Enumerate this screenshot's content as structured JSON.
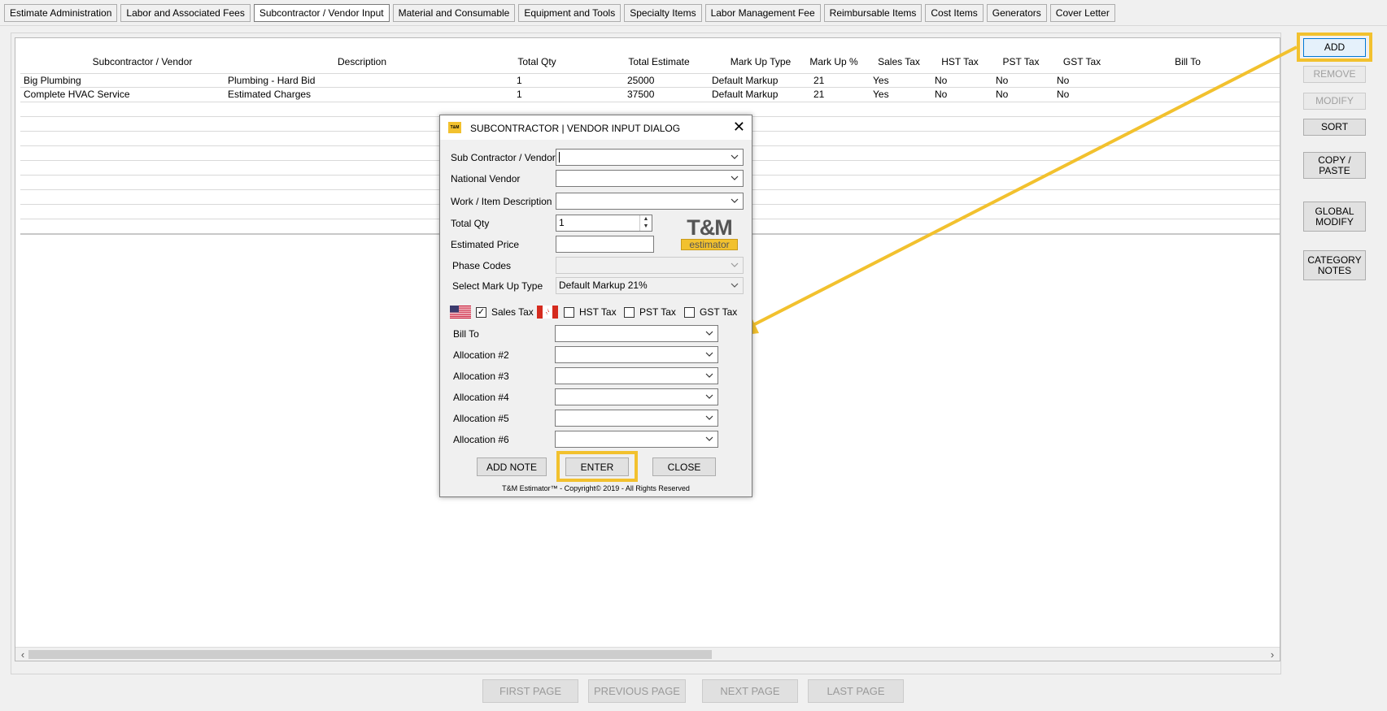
{
  "tabs": [
    {
      "label": "Estimate Administration"
    },
    {
      "label": "Labor and Associated Fees"
    },
    {
      "label": "Subcontractor / Vendor Input"
    },
    {
      "label": "Material and Consumable"
    },
    {
      "label": "Equipment and Tools"
    },
    {
      "label": "Specialty Items"
    },
    {
      "label": "Labor Management Fee"
    },
    {
      "label": "Reimbursable Items"
    },
    {
      "label": "Cost Items"
    },
    {
      "label": "Generators"
    },
    {
      "label": "Cover Letter"
    }
  ],
  "active_tab": "Subcontractor / Vendor Input",
  "table": {
    "columns": [
      "Subcontractor / Vendor",
      "Description",
      "Total Qty",
      "Total Estimate",
      "Mark Up Type",
      "Mark Up %",
      "Sales Tax",
      "HST Tax",
      "PST Tax",
      "GST Tax",
      "Bill To"
    ],
    "rows": [
      {
        "vendor": "Big Plumbing",
        "description": "Plumbing - Hard Bid",
        "qty": "1",
        "estimate": "25000",
        "markup_type": "Default Markup",
        "markup_pct": "21",
        "sales_tax": "Yes",
        "hst": "No",
        "pst": "No",
        "gst": "No",
        "bill_to": ""
      },
      {
        "vendor": "Complete HVAC Service",
        "description": "Estimated Charges",
        "qty": "1",
        "estimate": "37500",
        "markup_type": "Default Markup",
        "markup_pct": "21",
        "sales_tax": "Yes",
        "hst": "No",
        "pst": "No",
        "gst": "No",
        "bill_to": ""
      }
    ]
  },
  "side_buttons": {
    "add": "ADD",
    "remove": "REMOVE",
    "modify": "MODIFY",
    "sort": "SORT",
    "copy_paste_1": "COPY /",
    "copy_paste_2": "PASTE",
    "global_modify_1": "GLOBAL",
    "global_modify_2": "MODIFY",
    "category_notes_1": "CATEGORY",
    "category_notes_2": "NOTES"
  },
  "pager": {
    "first": "FIRST PAGE",
    "previous": "PREVIOUS PAGE",
    "next": "NEXT PAGE",
    "last": "LAST PAGE"
  },
  "dialog": {
    "logo_text": "T&M",
    "title": "SUBCONTRACTOR | VENDOR INPUT DIALOG",
    "fields": {
      "subcontractor_label": "Sub Contractor / Vendor",
      "subcontractor_value": "",
      "national_vendor_label": "National Vendor",
      "work_item_label": "Work / Item Description",
      "total_qty_label": "Total Qty",
      "total_qty_value": "1",
      "estimated_price_label": "Estimated Price",
      "estimated_price_value": "",
      "phase_codes_label": "Phase Codes",
      "markup_type_label": "Select Mark Up Type",
      "markup_type_value": "Default Markup 21%"
    },
    "taxes": {
      "sales": {
        "label": "Sales Tax",
        "checked": true
      },
      "hst": {
        "label": "HST Tax",
        "checked": false
      },
      "pst": {
        "label": "PST Tax",
        "checked": false
      },
      "gst": {
        "label": "GST Tax",
        "checked": false
      }
    },
    "allocations": {
      "bill_to": "Bill To",
      "a2": "Allocation #2",
      "a3": "Allocation #3",
      "a4": "Allocation #4",
      "a5": "Allocation #5",
      "a6": "Allocation #6"
    },
    "buttons": {
      "add_note": "ADD NOTE",
      "enter": "ENTER",
      "close": "CLOSE"
    },
    "brand": {
      "main": "T&M",
      "sub": "estimator"
    },
    "copyright": "T&M Estimator™ - Copyright© 2019 - All Rights Reserved"
  },
  "colors": {
    "highlight": "#f2c12e",
    "brand_yellow": "#f2c12e"
  }
}
